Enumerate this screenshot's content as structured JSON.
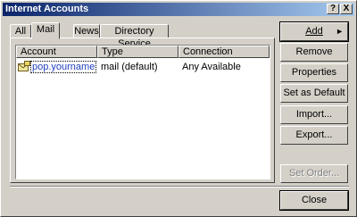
{
  "window": {
    "title": "Internet Accounts",
    "help_label": "?",
    "close_label": "X"
  },
  "tabs": [
    {
      "label": "All",
      "active": false
    },
    {
      "label": "Mail",
      "active": true
    },
    {
      "label": "News",
      "active": false
    },
    {
      "label": "Directory Service",
      "active": false
    }
  ],
  "list": {
    "columns": [
      "Account",
      "Type",
      "Connection"
    ],
    "rows": [
      {
        "account": "pop.yourname",
        "type": "mail (default)",
        "connection": "Any Available",
        "icon": "mail-account-icon"
      }
    ]
  },
  "buttons": {
    "add": "Add",
    "add_arrow": "►",
    "remove": "Remove",
    "properties": "Properties",
    "set_default": "Set as Default",
    "import": "Import...",
    "export": "Export...",
    "set_order": "Set Order...",
    "close": "Close"
  }
}
